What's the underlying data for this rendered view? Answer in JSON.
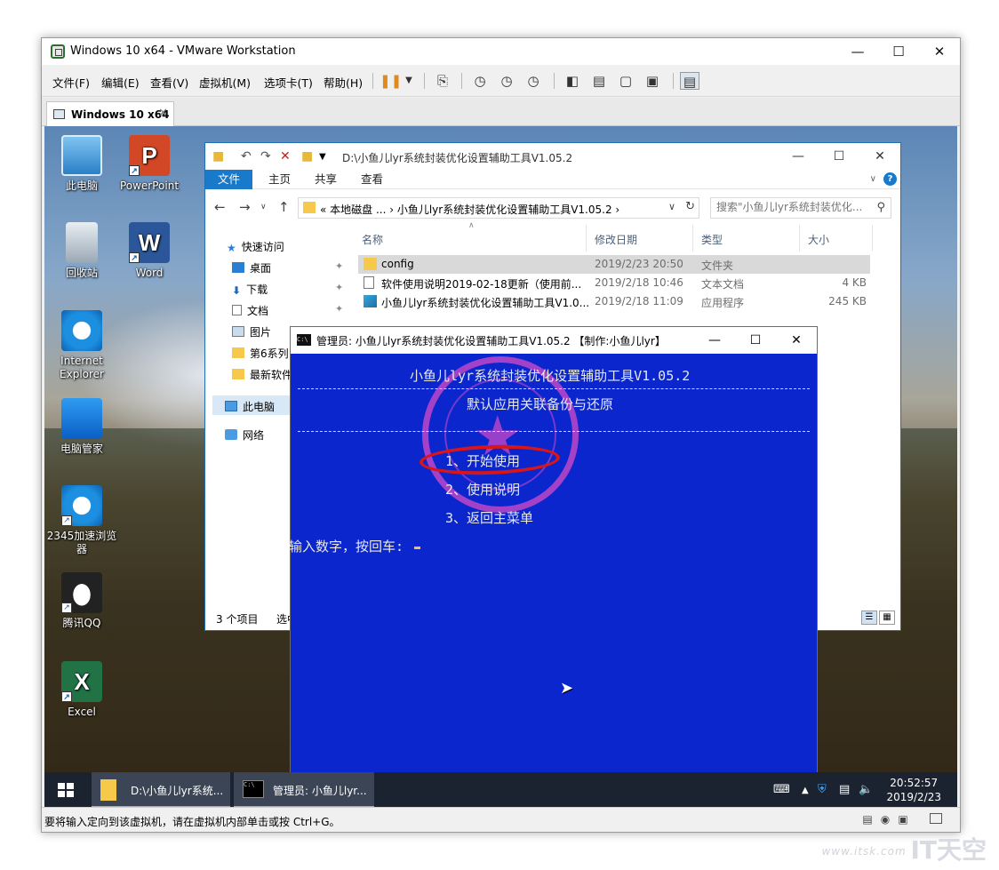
{
  "vmware": {
    "title": "Windows 10 x64 - VMware Workstation",
    "menu": [
      "文件(F)",
      "编辑(E)",
      "查看(V)",
      "虚拟机(M)",
      "选项卡(T)",
      "帮助(H)"
    ],
    "tab_label": "Windows 10 x64",
    "status_message": "要将输入定向到该虚拟机，请在虚拟机内部单击或按 Ctrl+G。"
  },
  "desktop": {
    "icons": [
      {
        "label": "此电脑",
        "icon": "this-pc-icon"
      },
      {
        "label": "PowerPoint",
        "icon": "powerpoint-icon"
      },
      {
        "label": "回收站",
        "icon": "recycle-bin-icon"
      },
      {
        "label": "Word",
        "icon": "word-icon"
      },
      {
        "label": "Internet Explorer",
        "icon": "ie-icon"
      },
      {
        "label": "电脑管家",
        "icon": "pc-manager-icon"
      },
      {
        "label": "2345加速浏览器",
        "icon": "browser-2345-icon"
      },
      {
        "label": "腾讯QQ",
        "icon": "qq-icon"
      },
      {
        "label": "Excel",
        "icon": "excel-icon"
      }
    ]
  },
  "explorer": {
    "title_path": "D:\\小鱼儿lyr系统封装优化设置辅助工具V1.05.2",
    "ribbon_tabs": [
      "文件",
      "主页",
      "共享",
      "查看"
    ],
    "address_crumbs": "«  本地磁盘 ...  ›  小鱼儿lyr系统封装优化设置辅助工具V1.05.2  ›",
    "search_placeholder": "搜索\"小鱼儿lyr系统封装优化...",
    "nav": {
      "quick_access": "快速访问",
      "desktop": "桌面",
      "downloads": "下载",
      "documents": "文档",
      "pictures": "图片",
      "folder1": "第6系列",
      "folder2": "最新软件",
      "this_pc": "此电脑",
      "network": "网络"
    },
    "columns": {
      "name": "名称",
      "date": "修改日期",
      "type": "类型",
      "size": "大小"
    },
    "files": [
      {
        "name": "config",
        "date": "2019/2/23 20:50",
        "type": "文件夹",
        "size": ""
      },
      {
        "name": "软件使用说明2019-02-18更新（使用前...",
        "date": "2019/2/18 10:46",
        "type": "文本文档",
        "size": "4 KB"
      },
      {
        "name": "小鱼儿lyr系统封装优化设置辅助工具V1.0...",
        "date": "2019/2/18 11:09",
        "type": "应用程序",
        "size": "245 KB"
      }
    ],
    "status_count": "3 个项目",
    "status_selected": "选中"
  },
  "console": {
    "title": "管理员:  小鱼儿lyr系统封装优化设置辅助工具V1.05.2 【制作:小鱼儿lyr】",
    "heading": "小鱼儿lyr系统封装优化设置辅助工具V1.05.2",
    "subheading": "默认应用关联备份与还原",
    "options": [
      "1、开始使用",
      "2、使用说明",
      "3、返回主菜单"
    ],
    "prompt": "输入数字，按回车:"
  },
  "taskbar": {
    "items": [
      "D:\\小鱼儿lyr系统...",
      "管理员:  小鱼儿lyr..."
    ],
    "time": "20:52:57",
    "date": "2019/2/23"
  },
  "watermark": {
    "site": "www.itsk.com",
    "brand": "IT天空"
  }
}
